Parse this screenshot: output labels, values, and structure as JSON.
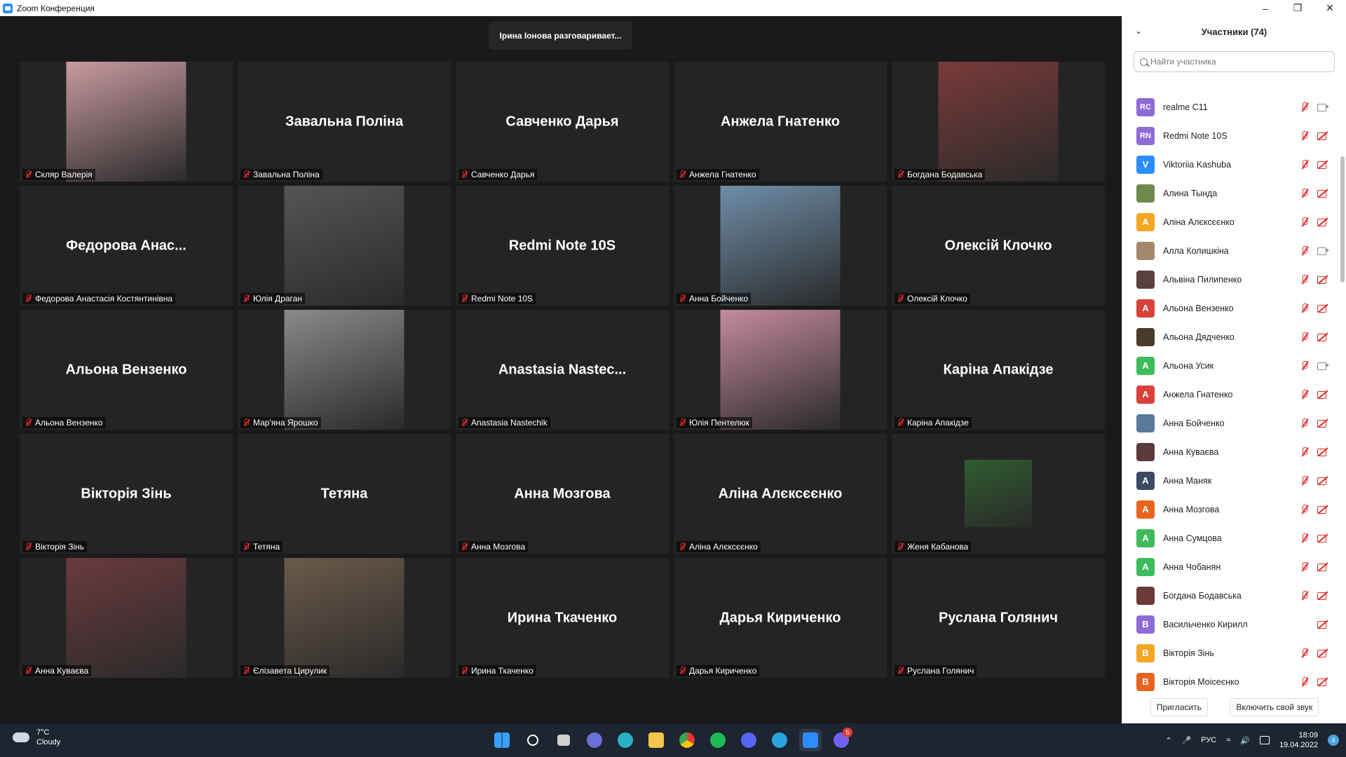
{
  "window": {
    "title": "Zoom Конференция"
  },
  "speaking": "Ірина Іонова разговаривает...",
  "tiles": [
    {
      "big": "",
      "label": "Скляр Валерія",
      "photo": true,
      "photo_color": "#c89aa0"
    },
    {
      "big": "Завальна Поліна",
      "label": "Завальна Поліна"
    },
    {
      "big": "Савченко Дарья",
      "label": "Савченко Дарья"
    },
    {
      "big": "Анжела Гнатенко",
      "label": "Анжела Гнатенко"
    },
    {
      "big": "",
      "label": "Богдана Бодавська",
      "photo": true,
      "photo_color": "#7a3a3a"
    },
    {
      "big": "Федорова  Анас...",
      "label": "Федорова Анастасія Костянтинівна"
    },
    {
      "big": "",
      "label": "Юлія Драган",
      "photo": true,
      "photo_color": "#555555"
    },
    {
      "big": "Redmi Note 10S",
      "label": "Redmi Note 10S"
    },
    {
      "big": "",
      "label": "Анна Бойченко",
      "photo": true,
      "photo_color": "#6f8ea8"
    },
    {
      "big": "Олексій Клочко",
      "label": "Олексій Клочко"
    },
    {
      "big": "Альона Вензенко",
      "label": "Альона Вензенко"
    },
    {
      "big": "",
      "label": "Мар'яна Ярошко",
      "photo": true,
      "photo_color": "#8a8a8a"
    },
    {
      "big": "Anastasia  Nastec...",
      "label": "Anastasia Nastechik"
    },
    {
      "big": "",
      "label": "Юлія Пентелюк",
      "photo": true,
      "photo_color": "#c58aa0"
    },
    {
      "big": "Каріна Апакідзе",
      "label": "Каріна Апакідзе"
    },
    {
      "big": "Вікторія Зінь",
      "label": "Вікторія Зінь"
    },
    {
      "big": "Тетяна",
      "label": "Тетяна"
    },
    {
      "big": "Анна Мозгова",
      "label": "Анна Мозгова"
    },
    {
      "big": "Аліна Алєксєєнко",
      "label": "Аліна Алєксєєнко"
    },
    {
      "big": "",
      "label": "Женя Кабанова",
      "photo": true,
      "small": true,
      "photo_color": "#2f5d2f"
    },
    {
      "big": "",
      "label": "Анна Куваєва",
      "photo": true,
      "photo_color": "#6a3a3e"
    },
    {
      "big": "",
      "label": "Єлізавета Цирулик",
      "photo": true,
      "photo_color": "#6b5a4a"
    },
    {
      "big": "Ирина Ткаченко",
      "label": "Ирина Ткаченко"
    },
    {
      "big": "Дарья Кириченко",
      "label": "Дарья Кириченко"
    },
    {
      "big": "Руслана Голянич",
      "label": "Руслана Голянич"
    }
  ],
  "panel": {
    "title": "Участники (74)",
    "search_placeholder": "Найти участника",
    "invite": "Пригласить",
    "unmute": "Включить свой звук",
    "participants": [
      {
        "initials": "RC",
        "name": "realme C11",
        "color": "#8e6bd6",
        "cam": "on",
        "mic": true
      },
      {
        "initials": "RN",
        "name": "Redmi Note 10S",
        "color": "#8e6bd6",
        "cam": "off",
        "mic": true
      },
      {
        "initials": "V",
        "name": "Viktoriia Kashuba",
        "color": "#2d8cff",
        "cam": "off",
        "mic": true
      },
      {
        "initials": "",
        "name": "Алина Тында",
        "color": "#6d8a4a",
        "cam": "off",
        "mic": true
      },
      {
        "initials": "А",
        "name": "Аліна Алєксєєнко",
        "color": "#f5a623",
        "cam": "off",
        "mic": true
      },
      {
        "initials": "",
        "name": "Алла Колишкіна",
        "color": "#a3886b",
        "cam": "on",
        "mic": true
      },
      {
        "initials": "",
        "name": "Альвіна Пилипенко",
        "color": "#5a4040",
        "cam": "off",
        "mic": true
      },
      {
        "initials": "А",
        "name": "Альона Вензенко",
        "color": "#d9413a",
        "cam": "off",
        "mic": true
      },
      {
        "initials": "",
        "name": "Альона Дядченко",
        "color": "#4a3a2a",
        "cam": "off",
        "mic": true
      },
      {
        "initials": "А",
        "name": "Альона Усик",
        "color": "#3dbb5c",
        "cam": "on",
        "mic": true
      },
      {
        "initials": "А",
        "name": "Анжела Гнатенко",
        "color": "#d9413a",
        "cam": "off",
        "mic": true
      },
      {
        "initials": "",
        "name": "Анна Бойченко",
        "color": "#5a7a9a",
        "cam": "off",
        "mic": true
      },
      {
        "initials": "",
        "name": "Анна Куваєва",
        "color": "#5a3a3a",
        "cam": "off",
        "mic": true
      },
      {
        "initials": "А",
        "name": "Анна Маняк",
        "color": "#3c4a63",
        "cam": "off",
        "mic": true
      },
      {
        "initials": "А",
        "name": "Анна Мозгова",
        "color": "#e8641e",
        "cam": "off",
        "mic": true
      },
      {
        "initials": "А",
        "name": "Анна Сумцова",
        "color": "#3dbb5c",
        "cam": "off",
        "mic": true
      },
      {
        "initials": "А",
        "name": "Анна Чобанян",
        "color": "#3dbb5c",
        "cam": "off",
        "mic": true
      },
      {
        "initials": "",
        "name": "Богдана Бодавська",
        "color": "#6a3a3a",
        "cam": "off",
        "mic": true
      },
      {
        "initials": "В",
        "name": "Васильченко Кирилл",
        "color": "#8e6bd6",
        "cam": "off",
        "mic": false
      },
      {
        "initials": "В",
        "name": "Вікторія Зінь",
        "color": "#f5a623",
        "cam": "off",
        "mic": true
      },
      {
        "initials": "В",
        "name": "Вікторія Моісеєнко",
        "color": "#e8641e",
        "cam": "off",
        "mic": true
      }
    ]
  },
  "taskbar": {
    "temp": "7°C",
    "weather": "Cloudy",
    "lang": "РУС",
    "time": "18:09",
    "date": "19.04.2022",
    "badge_count": "5",
    "notif_count": "4"
  }
}
